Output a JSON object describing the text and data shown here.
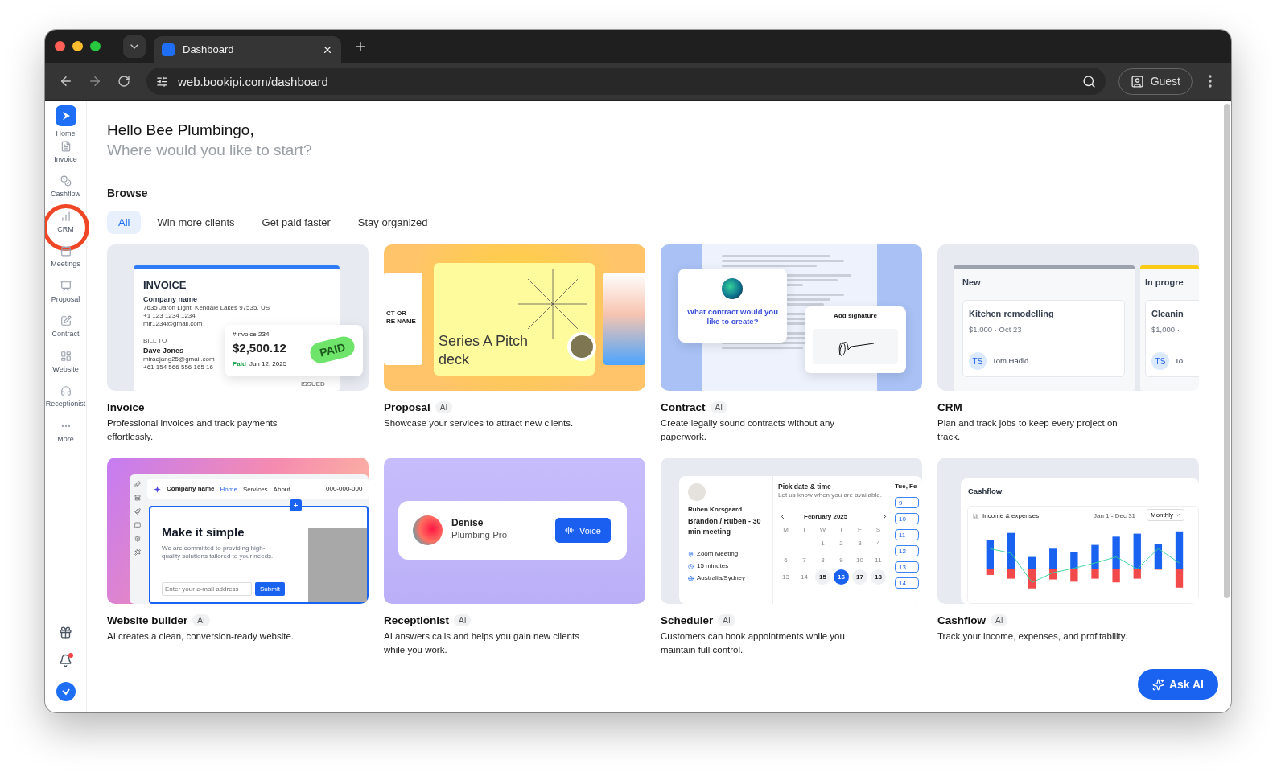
{
  "browser": {
    "tab_title": "Dashboard",
    "url": "web.bookipi.com/dashboard",
    "profile": "Guest"
  },
  "sidebar": {
    "items": [
      {
        "label": "Home",
        "kind": "logo",
        "circled": false
      },
      {
        "label": "Invoice",
        "kind": "nav",
        "circled": false
      },
      {
        "label": "Cashflow",
        "kind": "nav",
        "circled": false
      },
      {
        "label": "CRM",
        "kind": "nav",
        "circled": true
      },
      {
        "label": "Meetings",
        "kind": "nav",
        "circled": false
      },
      {
        "label": "Proposal",
        "kind": "nav",
        "circled": false
      },
      {
        "label": "Contract",
        "kind": "nav",
        "circled": false
      },
      {
        "label": "Website",
        "kind": "nav",
        "circled": false
      },
      {
        "label": "Receptionist",
        "kind": "nav",
        "circled": false
      },
      {
        "label": "More",
        "kind": "nav",
        "circled": false
      }
    ],
    "notification_dot": true
  },
  "greeting": {
    "title": "Hello Bee Plumbingo,",
    "subtitle": "Where would you like to start?"
  },
  "browse": {
    "heading": "Browse",
    "filters": [
      {
        "label": "All",
        "selected": true
      },
      {
        "label": "Win more clients",
        "selected": false
      },
      {
        "label": "Get paid faster",
        "selected": false
      },
      {
        "label": "Stay organized",
        "selected": false
      }
    ]
  },
  "cards": [
    {
      "kind": "invoice",
      "title": "Invoice",
      "description": "Professional invoices and track payments effortlessly.",
      "preview": {
        "heading": "INVOICE",
        "company": "Company name",
        "address": [
          "7635 Jaron Light, Kendale Lakes 97535, US",
          "+1 123 1234 1234",
          "mir1234@gmail.com"
        ],
        "bill_to": "BILL TO",
        "client": "Dave Jones",
        "client_lines": [
          "miraejang25@gmail.com",
          "+61 154 566 556 165 16"
        ],
        "issued": "ISSUED",
        "number": "#Invoice 234",
        "amount": "$2,500.12",
        "status": "Paid",
        "date": "Jun 12, 2025",
        "stamp": "PAID"
      }
    },
    {
      "kind": "proposal",
      "title": "Proposal",
      "badge": "AI",
      "description": "Showcase your services to attract new clients.",
      "preview": {
        "side_lines": [
          "CT OR",
          "RE NAME"
        ],
        "deck_title": "Series A Pitch deck"
      }
    },
    {
      "kind": "contract",
      "title": "Contract",
      "badge": "AI",
      "description": "Create legally sound contracts without any paperwork.",
      "preview": {
        "question": "What contract would you like to create?",
        "signature": "Add signature"
      }
    },
    {
      "kind": "crm",
      "title": "CRM",
      "description": "Plan and track jobs to keep every project on track.",
      "preview": {
        "columns": [
          {
            "title": "New",
            "color": "#9ca3af",
            "job": "Kitchen remodelling",
            "meta": "$1,000 · Oct 23",
            "initials": "TS",
            "person": "Tom Hadid"
          },
          {
            "title": "In progre",
            "color": "#facc15",
            "job": "Cleanin",
            "meta": "$1,000 ·",
            "initials": "TS",
            "person": "To"
          }
        ]
      }
    },
    {
      "kind": "website",
      "title": "Website builder",
      "badge": "AI",
      "description": "AI creates a clean, conversion-ready website.",
      "preview": {
        "company": "Company name",
        "nav": [
          {
            "label": "Home",
            "selected": true
          },
          {
            "label": "Services",
            "selected": false
          },
          {
            "label": "About",
            "selected": false
          }
        ],
        "phone": "000-000-000",
        "add": "+",
        "heading": "Make it simple",
        "text": "We are committed to providing high-quality solutions tailored to your needs.",
        "placeholder": "Enter your e-mail address",
        "button": "Submit"
      }
    },
    {
      "kind": "receptionist",
      "title": "Receptionist",
      "badge": "AI",
      "description": "AI answers calls and helps you gain new clients while you work.",
      "preview": {
        "name": "Denise",
        "role": "Plumbing Pro",
        "button": "Voice"
      }
    },
    {
      "kind": "scheduler",
      "title": "Scheduler",
      "badge": "AI",
      "description": "Customers can book appointments while you maintain full control.",
      "preview": {
        "host": "Ruben Korsgaard",
        "meeting": "Brandon / Ruben - 30 min meeting",
        "details": [
          "Zoom Meeting",
          "15 minutes",
          "Australia/Sydney"
        ],
        "picker_title": "Pick date & time",
        "picker_hint": "Let us know when you are available.",
        "month": "February 2025",
        "weekdays": [
          "M",
          "T",
          "W",
          "T",
          "F",
          "S"
        ],
        "days": [
          {
            "d": "1",
            "available": false,
            "selected": false
          },
          {
            "d": "2",
            "available": false,
            "selected": false
          },
          {
            "d": "3",
            "available": false,
            "selected": false
          },
          {
            "d": "4",
            "available": false,
            "selected": false
          },
          {
            "d": "6",
            "available": false,
            "selected": false
          },
          {
            "d": "7",
            "available": false,
            "selected": false
          },
          {
            "d": "8",
            "available": false,
            "selected": false
          },
          {
            "d": "9",
            "available": false,
            "selected": false
          },
          {
            "d": "10",
            "available": false,
            "selected": false
          },
          {
            "d": "11",
            "available": false,
            "selected": false
          },
          {
            "d": "13",
            "available": false,
            "selected": false
          },
          {
            "d": "14",
            "available": false,
            "selected": false
          },
          {
            "d": "15",
            "available": true,
            "selected": false
          },
          {
            "d": "16",
            "available": true,
            "selected": true
          },
          {
            "d": "17",
            "available": true,
            "selected": false
          },
          {
            "d": "18",
            "available": true,
            "selected": false
          }
        ],
        "day_title": "Tue, Fe",
        "slots": [
          "9",
          "10",
          "11",
          "12",
          "13",
          "14"
        ]
      }
    },
    {
      "kind": "cashflow",
      "title": "Cashflow",
      "badge": "AI",
      "description": "Track your income, expenses, and profitability.",
      "preview": {
        "title": "Cashflow",
        "chart_label": "Income & expenses",
        "range": "Jan 1 - Dec 31",
        "period": "Monthly"
      }
    }
  ],
  "ask_ai": "Ask AI"
}
